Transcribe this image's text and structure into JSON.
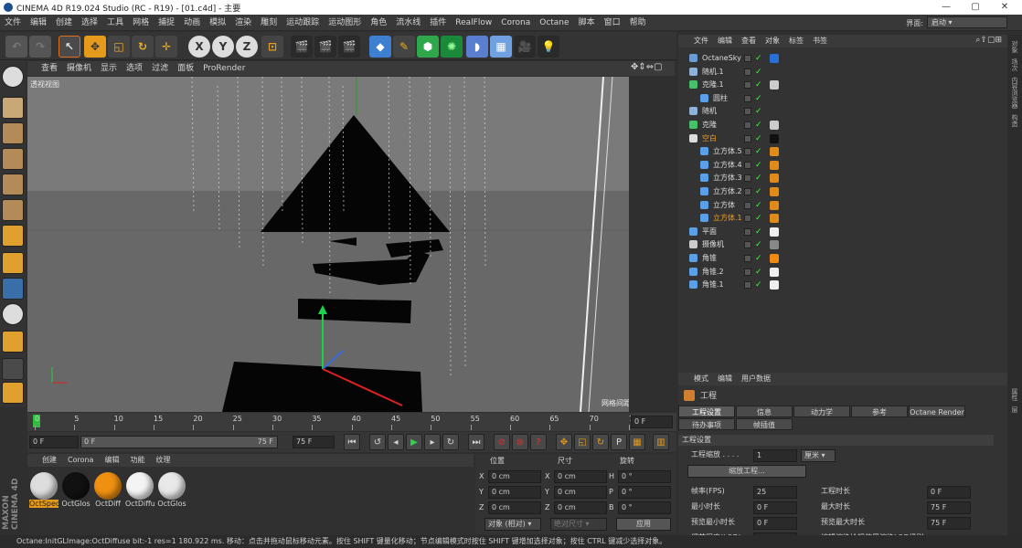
{
  "window": {
    "title": "CINEMA 4D R19.024 Studio (RC - R19) - [01.c4d] - 主要"
  },
  "menu": [
    "文件",
    "编辑",
    "创建",
    "选择",
    "工具",
    "网格",
    "捕捉",
    "动画",
    "模拟",
    "渲染",
    "雕刻",
    "运动跟踪",
    "运动图形",
    "角色",
    "流水线",
    "插件",
    "RealFlow",
    "Corona",
    "Octane",
    "脚本",
    "窗口",
    "帮助"
  ],
  "layout": {
    "label": "界面:",
    "value": "启动"
  },
  "viewport": {
    "menu": [
      "查看",
      "摄像机",
      "显示",
      "选项",
      "过滤",
      "面板",
      "ProRender"
    ],
    "name": "透视视图",
    "grid_label": "网格间距 : 100 cm"
  },
  "timeline": {
    "ticks": [
      "0",
      "5",
      "10",
      "15",
      "20",
      "25",
      "30",
      "35",
      "40",
      "45",
      "50",
      "55",
      "60",
      "65",
      "70",
      "75"
    ],
    "end_field": "0 F",
    "current": 0,
    "min": 0,
    "max": 75
  },
  "transport": {
    "start": "0 F",
    "range_start": "0 F",
    "range_end": "75 F",
    "end": "75 F"
  },
  "materials": {
    "menu": [
      "创建",
      "Corona",
      "编辑",
      "功能",
      "纹理"
    ],
    "items": [
      "OctSpec",
      "OctGlos",
      "OctDiff",
      "OctDiffu",
      "OctGlos"
    ]
  },
  "coords": {
    "headers": [
      "位置",
      "尺寸",
      "旋转"
    ],
    "rows": [
      {
        "a": "X",
        "v1": "0 cm",
        "b": "X",
        "v2": "0 cm",
        "c": "H",
        "v3": "0 °"
      },
      {
        "a": "Y",
        "v1": "0 cm",
        "b": "Y",
        "v2": "0 cm",
        "c": "P",
        "v3": "0 °"
      },
      {
        "a": "Z",
        "v1": "0 cm",
        "b": "Z",
        "v2": "0 cm",
        "c": "B",
        "v3": "0 °"
      }
    ],
    "mode": "对象 (相对)",
    "size_mode": "绝对尺寸",
    "apply": "应用"
  },
  "objects": {
    "menu": [
      "文件",
      "编辑",
      "查看",
      "对象",
      "标签",
      "书签"
    ],
    "items": [
      {
        "name": "OctaneSky",
        "indent": 0,
        "icon": "#6b9bd6",
        "tag": "#2a6fd6",
        "hl": false
      },
      {
        "name": "随机.1",
        "indent": 0,
        "icon": "#8fb0d8",
        "tag": "",
        "hl": false
      },
      {
        "name": "克隆.1",
        "indent": 0,
        "icon": "#47c06a",
        "tag": "#cccccc",
        "hl": false
      },
      {
        "name": "圆柱",
        "indent": 1,
        "icon": "#5aa0e8",
        "tag": "",
        "hl": false
      },
      {
        "name": "随机",
        "indent": 0,
        "icon": "#8fb0d8",
        "tag": "",
        "hl": false
      },
      {
        "name": "克隆",
        "indent": 0,
        "icon": "#47c06a",
        "tag": "#cccccc",
        "hl": false
      },
      {
        "name": "空白",
        "indent": 0,
        "icon": "#dddddd",
        "tag": "#111111",
        "hl": true
      },
      {
        "name": "立方体.5",
        "indent": 1,
        "icon": "#5aa0e8",
        "tag": "#e08a1a",
        "hl": false
      },
      {
        "name": "立方体.4",
        "indent": 1,
        "icon": "#5aa0e8",
        "tag": "#e08a1a",
        "hl": false
      },
      {
        "name": "立方体.3",
        "indent": 1,
        "icon": "#5aa0e8",
        "tag": "#e08a1a",
        "hl": false
      },
      {
        "name": "立方体.2",
        "indent": 1,
        "icon": "#5aa0e8",
        "tag": "#e08a1a",
        "hl": false
      },
      {
        "name": "立方体",
        "indent": 1,
        "icon": "#5aa0e8",
        "tag": "#e08a1a",
        "hl": false
      },
      {
        "name": "立方体.1",
        "indent": 1,
        "icon": "#5aa0e8",
        "tag": "#e08a1a",
        "hl": true
      },
      {
        "name": "平面",
        "indent": 0,
        "icon": "#5aa0e8",
        "tag": "#eeeeee",
        "hl": false
      },
      {
        "name": "摄像机",
        "indent": 0,
        "icon": "#cccccc",
        "tag": "#888888",
        "hl": false
      },
      {
        "name": "角锥",
        "indent": 0,
        "icon": "#5aa0e8",
        "tag": "#f08a10",
        "hl": false
      },
      {
        "name": "角锥.2",
        "indent": 0,
        "icon": "#5aa0e8",
        "tag": "#eeeeee",
        "hl": false
      },
      {
        "name": "角锥.1",
        "indent": 0,
        "icon": "#5aa0e8",
        "tag": "#eeeeee",
        "hl": false
      }
    ]
  },
  "attributes": {
    "menu": [
      "模式",
      "编辑",
      "用户数据"
    ],
    "title": "工程",
    "tabs": [
      "工程设置",
      "信息",
      "动力学",
      "参考",
      "Octane Render"
    ],
    "tabs2": [
      "待办事项",
      "帧插值"
    ],
    "section": "工程设置",
    "scale_label": "工程缩放 . . . .",
    "scale_value": "1",
    "scale_unit": "厘米",
    "scale_btn": "缩放工程...",
    "fields_left": [
      {
        "label": "帧率(FPS)",
        "value": "25"
      },
      {
        "label": "最小时长",
        "value": "0 F"
      },
      {
        "label": "预览最小时长",
        "value": "0 F"
      },
      {
        "label": "细节程度(LOD)",
        "value": "100 %"
      }
    ],
    "fields_right": [
      {
        "label": "工程时长",
        "value": "0 F"
      },
      {
        "label": "最大时长",
        "value": "75 F"
      },
      {
        "label": "预览最大时长",
        "value": "75 F"
      },
      {
        "label": "编辑渲染检视使用渲染LOD级别",
        "value": ""
      }
    ]
  },
  "sidebar": [
    "对象",
    "场次",
    "内容浏览器",
    "构造"
  ],
  "sidebar2": [
    "属性",
    "层"
  ],
  "status": "Octane:InitGLImage:OctDiffuse  bit:-1 res=1  180.922 ms.   移动：点击并拖动鼠标移动元素。按住 SHIFT 键量化移动；节点编辑模式时按住 SHIFT 键增加选择对象；按住 CTRL 键减少选择对象。"
}
